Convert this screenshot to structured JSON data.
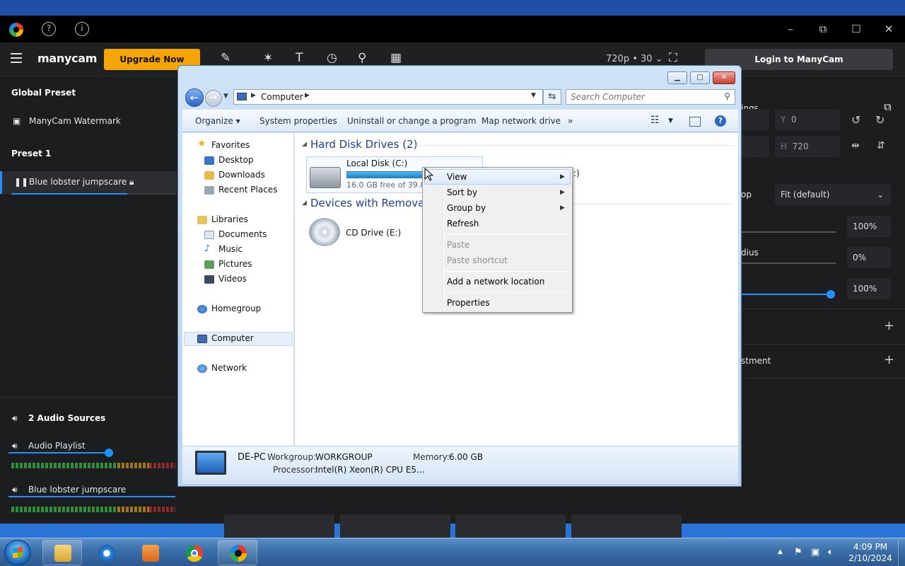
{
  "manycam": {
    "title_icons": {
      "help": "?",
      "info": "i"
    },
    "window_controls": {
      "minimize": "–",
      "restore": "⧉",
      "maximize": "☐",
      "close": "✕"
    },
    "brand": "manycam",
    "upgrade_label": "Upgrade Now",
    "resolution": "720p • 30 ⌄",
    "login_label": "Login to ManyCam",
    "left_panel": {
      "global_preset": "Global Preset",
      "watermark": "ManyCam Watermark",
      "preset_header": "Preset 1",
      "preset_item": "Blue lobster jumpscare",
      "audio_header": "2 Audio Sources",
      "audio_playlist": "Audio Playlist",
      "audio_item": "Blue lobster jumpscare",
      "audio_playlist_level": 0.6,
      "audio_item_level": 1.0
    },
    "right_panel": {
      "settings_label": "ings",
      "y_label": "Y",
      "y_value": "0",
      "h_label": "H",
      "h_value": "720",
      "crop_label": "op",
      "fit_value": "Fit (default)",
      "opacity_value": "100%",
      "radius_label": "dius",
      "radius_value": "0%",
      "volume_value": "100%",
      "adjustment_label": "stment"
    }
  },
  "explorer": {
    "caption_buttons": {
      "minimize": "▁",
      "maximize": "□",
      "close": "✕"
    },
    "address": "Computer",
    "search_placeholder": "Search Computer",
    "commands": [
      "Organize ▾",
      "System properties",
      "Uninstall or change a program",
      "Map network drive",
      "»"
    ],
    "nav": {
      "favorites": "Favorites",
      "desktop": "Desktop",
      "downloads": "Downloads",
      "recent": "Recent Places",
      "libraries": "Libraries",
      "documents": "Documents",
      "music": "Music",
      "pictures": "Pictures",
      "videos": "Videos",
      "homegroup": "Homegroup",
      "computer": "Computer",
      "network": "Network"
    },
    "groups": {
      "hdd": "Hard Disk Drives (2)",
      "removable": "Devices with Removable"
    },
    "local_disk": {
      "name": "Local Disk (C:)",
      "free": "16.0 GB free of 39.0 G",
      "used_fraction": 0.59
    },
    "second_drive_fragment": ":)",
    "cd_drive": "CD Drive (E:)",
    "details": {
      "pc_name": "DE-PC",
      "workgroup_label": "Workgroup:",
      "workgroup": "WORKGROUP",
      "memory_label": "Memory:",
      "memory": "6.00 GB",
      "processor_label": "Processor:",
      "processor": "Intel(R) Xeon(R) CPU E5..."
    }
  },
  "context_menu": {
    "view": "View",
    "sort_by": "Sort by",
    "group_by": "Group by",
    "refresh": "Refresh",
    "paste": "Paste",
    "paste_shortcut": "Paste shortcut",
    "add_network_location": "Add a network location",
    "properties": "Properties"
  },
  "taskbar": {
    "time": "4:09 PM",
    "date": "2/10/2024"
  },
  "colors": {
    "manycam_accent": "#1e90ff",
    "upgrade": "#f7a500",
    "explorer_group": "#1e3f8a"
  }
}
